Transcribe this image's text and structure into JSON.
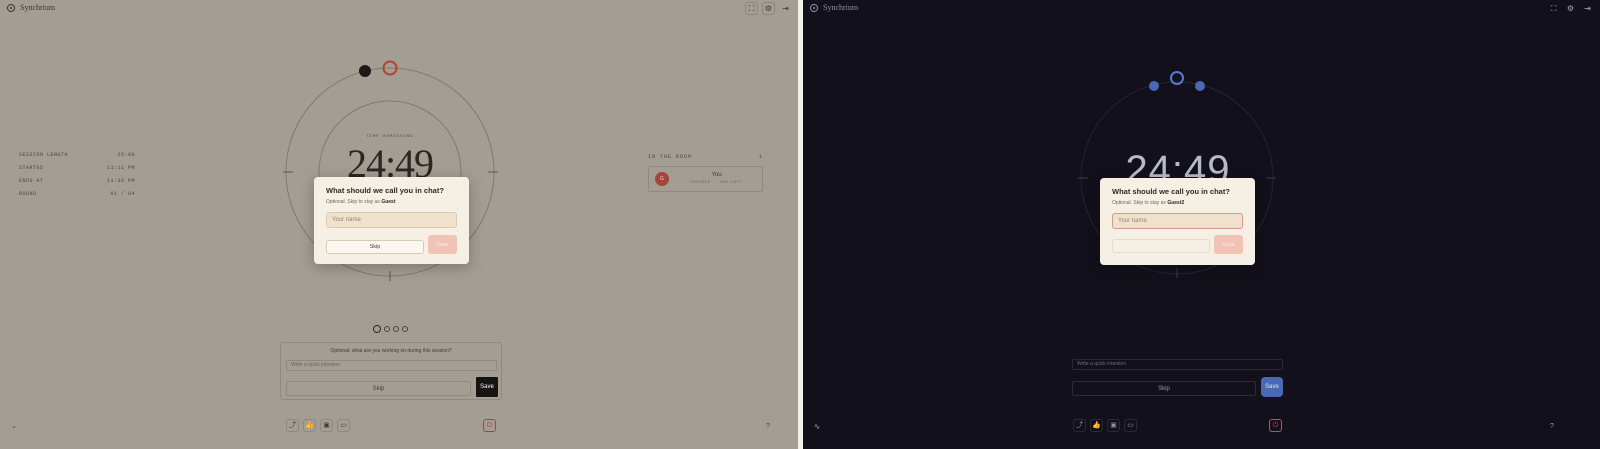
{
  "app": {
    "brand": "Synchrium"
  },
  "header": {
    "icons": [
      "fullscreen-icon",
      "settings-icon",
      "exit-icon"
    ],
    "glyphs": {
      "fullscreen": "⛶",
      "settings": "⚙",
      "exit": "⇥"
    }
  },
  "stats": [
    {
      "label": "SESSION LENGTH",
      "value": "25:00"
    },
    {
      "label": "STARTED",
      "value": "11:11 PM"
    },
    {
      "label": "ENDS AT",
      "value": "11:36 PM"
    },
    {
      "label": "ROUND",
      "value": "01 / 04"
    }
  ],
  "timer": {
    "label": "TIME REMAINING",
    "value": "24:49"
  },
  "room": {
    "heading": "IN THE ROOM",
    "count": "1",
    "member": {
      "initial": "G",
      "name": "You",
      "status": "FOCUSED · 24M LEFT"
    }
  },
  "rounds": {
    "total": 4,
    "current": 1
  },
  "task_prompt": {
    "question": "Optional: what are you working on during this session?",
    "placeholder": "Write a quick intention",
    "skip_label": "Skip",
    "save_label": "Save"
  },
  "dark_task": {
    "placeholder": "Write a quick intention",
    "skip_label": "Skip",
    "save_label": "Save"
  },
  "modal": {
    "title": "What should we call you in chat?",
    "subtitle_prefix": "Optional. Skip to stay as",
    "guest_name": "Guest",
    "placeholder": "Your name",
    "skip_label": "Skip",
    "save_label": "Save"
  },
  "dark_modal": {
    "title": "What should we call you in chat?",
    "subtitle_prefix": "Optional. Skip to stay as",
    "guest_name": "Guest2",
    "placeholder": "Your name",
    "save_label": "Save"
  },
  "bottom": {
    "icons": [
      "share-icon",
      "thumbs-up-icon",
      "picture-in-picture-icon",
      "chat-icon"
    ],
    "glyphs": {
      "share": "⤴",
      "like": "👍",
      "pip": "▣",
      "chat": "▭",
      "power": "⏻",
      "chevron": "⌄",
      "help": "?",
      "wave": "∿"
    }
  },
  "colors": {
    "light_bg": "#a39d93",
    "dark_bg": "#12111b",
    "accent_red": "#a5443a",
    "accent_blue": "#4a68b4",
    "save_peach": "#f0c3b4"
  }
}
